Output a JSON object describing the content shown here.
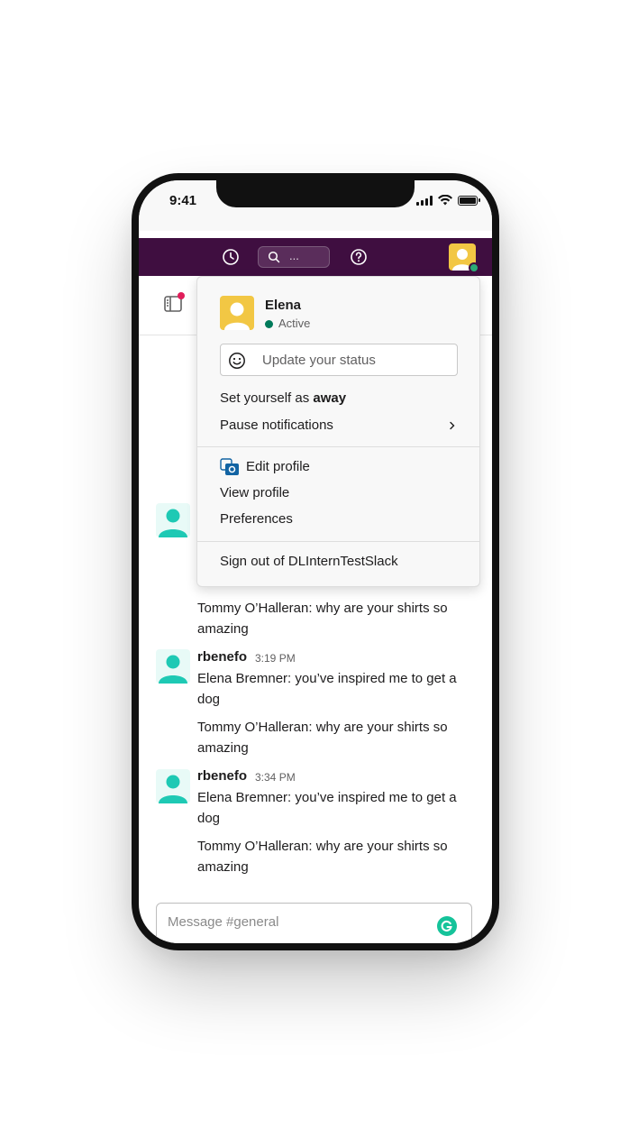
{
  "status_bar": {
    "time": "9:41"
  },
  "topbar": {
    "search_placeholder": "..."
  },
  "menu": {
    "user_name": "Elena",
    "presence": "Active",
    "status_placeholder": "Update your status",
    "set_away_prefix": "Set yourself as ",
    "set_away_bold": "away",
    "pause_notifications": "Pause notifications",
    "edit_profile": "Edit profile",
    "view_profile": "View profile",
    "preferences": "Preferences",
    "sign_out": "Sign out of DLInternTestSlack"
  },
  "messages": {
    "partial_line": "dog",
    "partial_line2": "Tommy O’Halleran: why are your shirts so",
    "partial_line3": "amazing",
    "items": [
      {
        "author": "rbenefo",
        "time": "3:19 PM",
        "line1": "Elena Bremner: you’ve inspired me to get a",
        "line2": "dog",
        "line3": "Tommy O’Halleran: why are your shirts so",
        "line4": "amazing"
      },
      {
        "author": "rbenefo",
        "time": "3:34 PM",
        "line1": "Elena Bremner: you’ve inspired me to get a",
        "line2": "dog",
        "line3": "Tommy O’Halleran: why are your shirts so",
        "line4": "amazing"
      }
    ]
  },
  "composer": {
    "placeholder": "Message #general"
  },
  "colors": {
    "topbar": "#3f0e40",
    "presence": "#2bac76",
    "avatar_teal": "#1ec9b4",
    "unread": "#e01e5a"
  }
}
